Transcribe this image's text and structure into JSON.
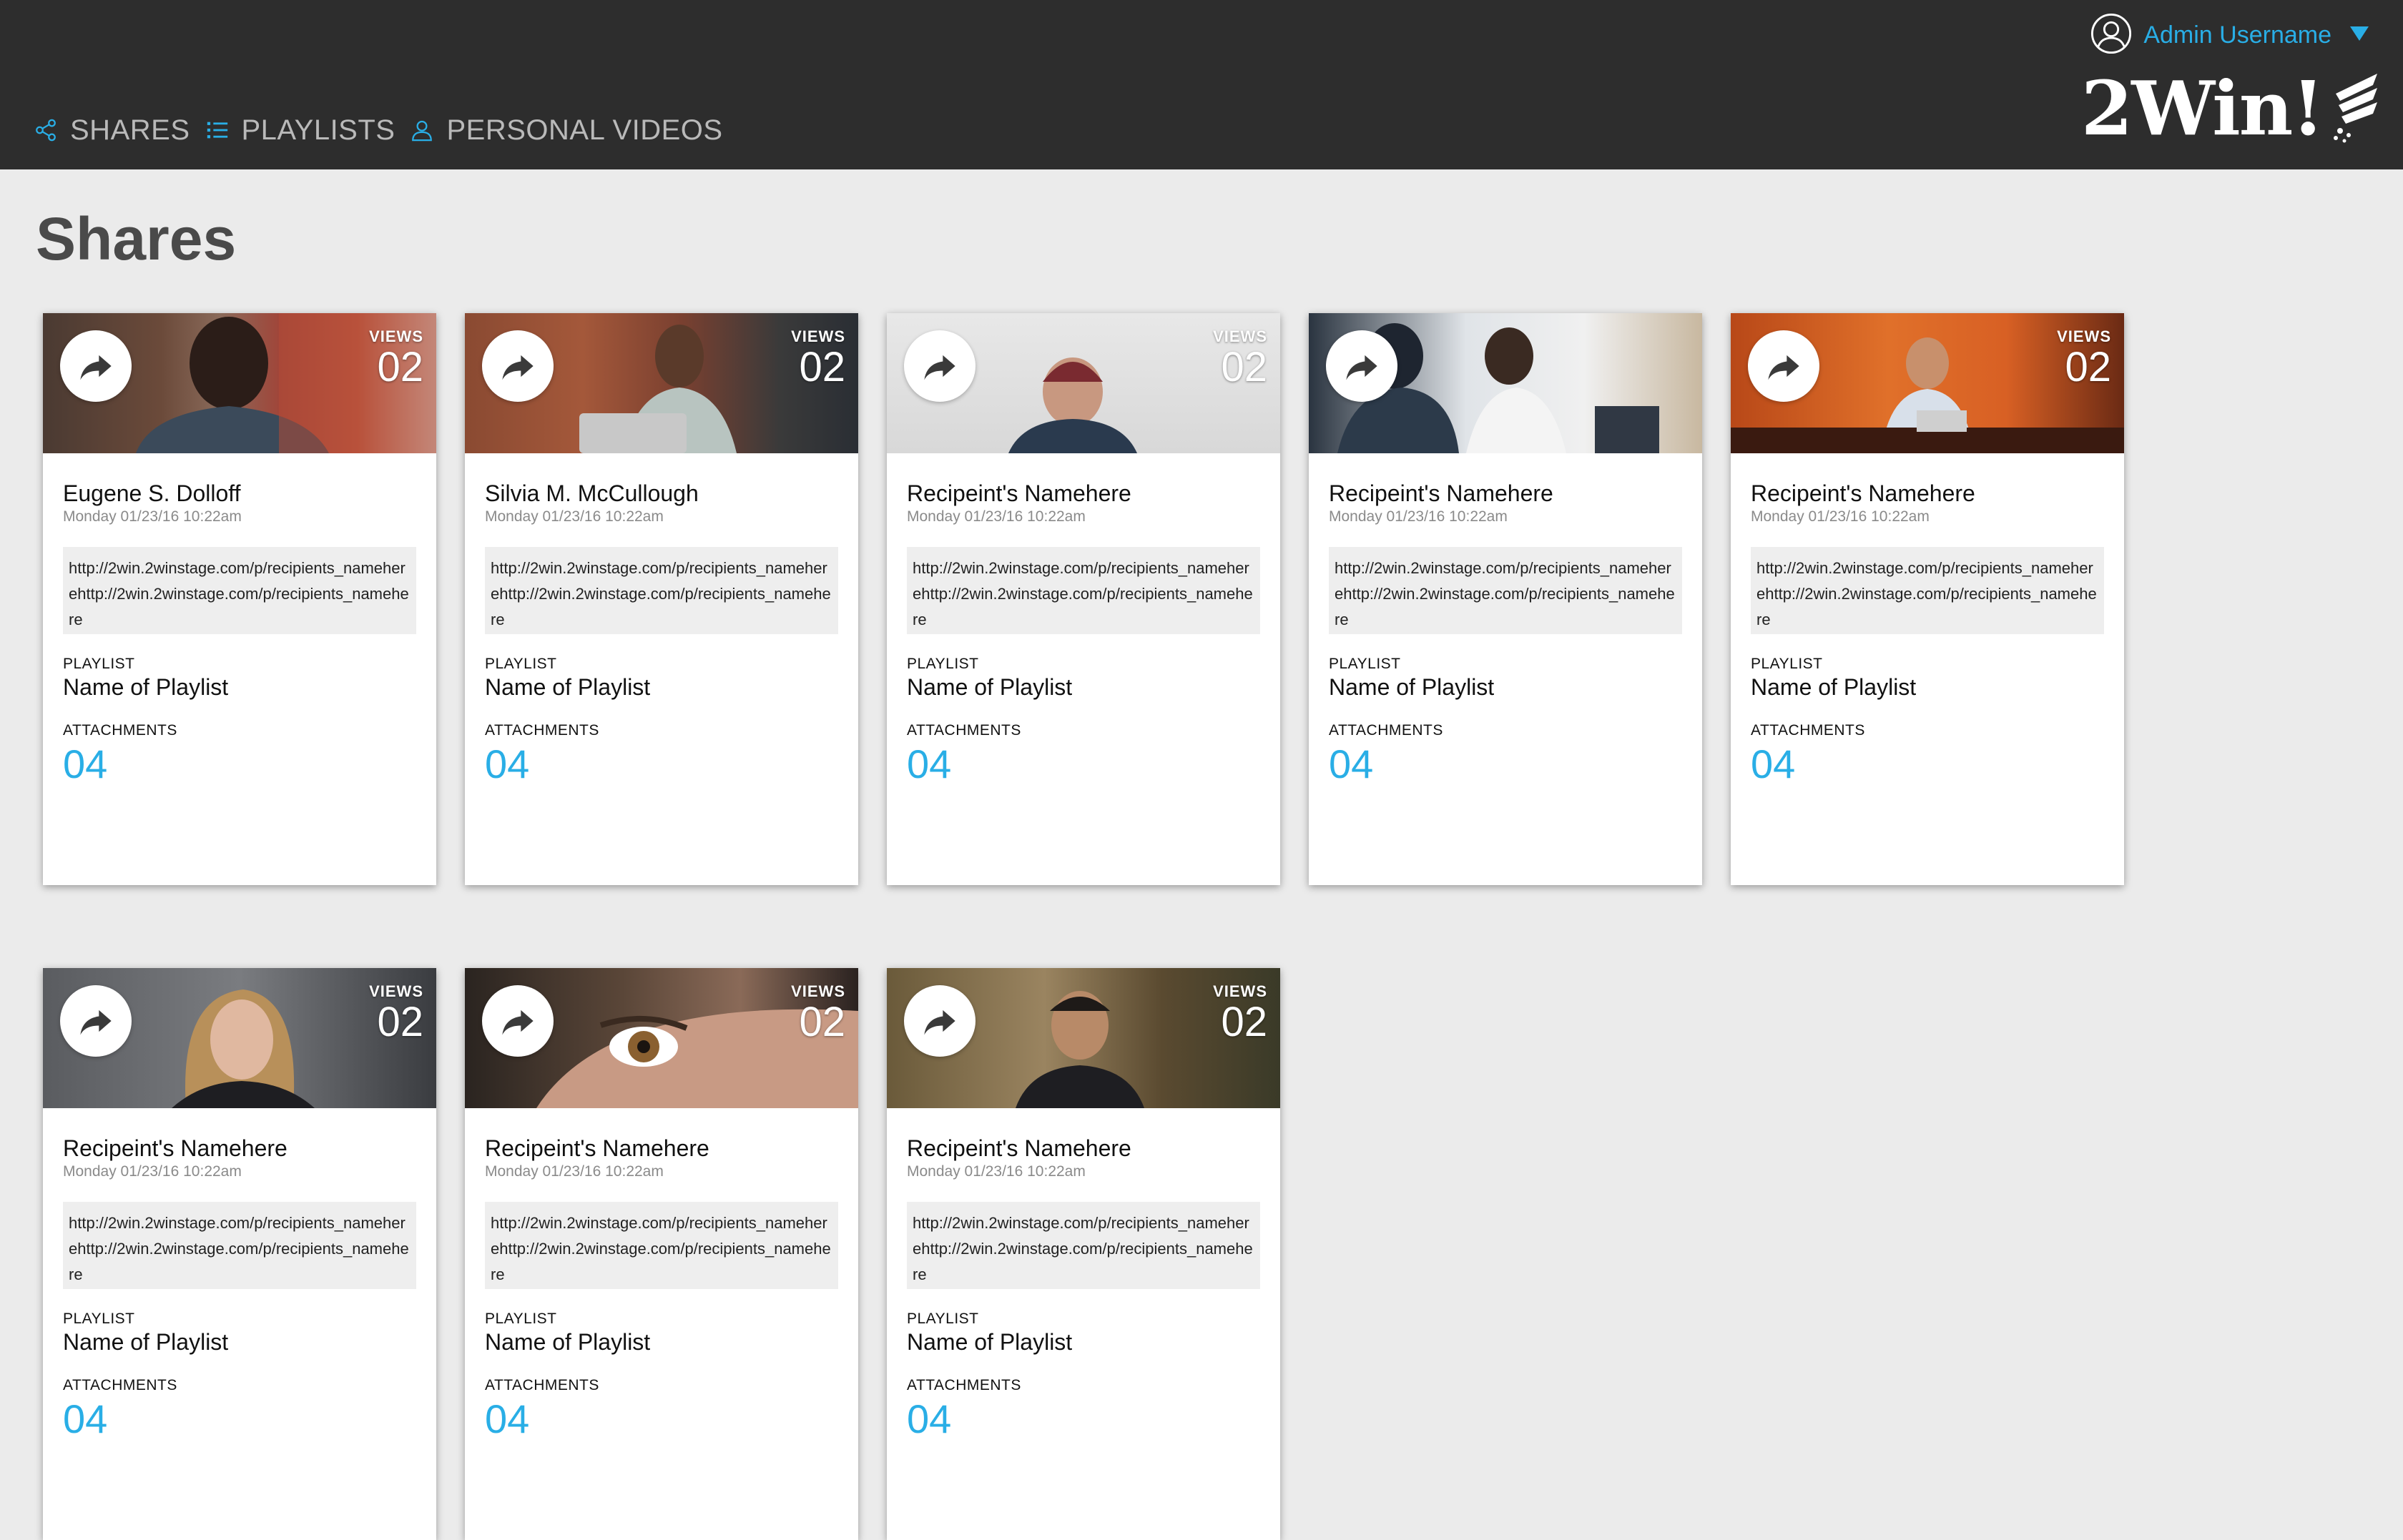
{
  "nav": {
    "items": [
      {
        "label": "SHARES"
      },
      {
        "label": "PLAYLISTS"
      },
      {
        "label": "PERSONAL VIDEOS"
      }
    ]
  },
  "user": {
    "name": "Admin Username",
    "menu_icon": "caret-down-icon"
  },
  "logo": {
    "text": "2Win!"
  },
  "page": {
    "title": "Shares"
  },
  "colors": {
    "accent": "#29aee6",
    "topbar": "#2d2d2d",
    "background": "#ebebeb"
  },
  "cards": [
    {
      "name": "Eugene S. Dolloff",
      "date": "Monday 01/23/16 10:22am",
      "link": "http://2win.2winstage.com/p/recipients_nameherehttp://2win.2winstage.com/p/recipients_namehere",
      "views_label": "VIEWS",
      "views": "02",
      "playlist_label": "PLAYLIST",
      "playlist": "Name of Playlist",
      "attachments_label": "ATTACHMENTS",
      "attachments": "04"
    },
    {
      "name": "Silvia M. McCullough",
      "date": "Monday 01/23/16 10:22am",
      "link": "http://2win.2winstage.com/p/recipients_nameherehttp://2win.2winstage.com/p/recipients_namehere",
      "views_label": "VIEWS",
      "views": "02",
      "playlist_label": "PLAYLIST",
      "playlist": "Name of Playlist",
      "attachments_label": "ATTACHMENTS",
      "attachments": "04"
    },
    {
      "name": "Recipeint's Namehere",
      "date": "Monday 01/23/16 10:22am",
      "link": "http://2win.2winstage.com/p/recipients_nameherehttp://2win.2winstage.com/p/recipients_namehere",
      "views_label": "VIEWS",
      "views": "02",
      "playlist_label": "PLAYLIST",
      "playlist": "Name of Playlist",
      "attachments_label": "ATTACHMENTS",
      "attachments": "04"
    },
    {
      "name": "Recipeint's Namehere",
      "date": "Monday 01/23/16 10:22am",
      "link": "http://2win.2winstage.com/p/recipients_nameherehttp://2win.2winstage.com/p/recipients_namehere",
      "views_label": "VIEWS",
      "views": "02",
      "playlist_label": "PLAYLIST",
      "playlist": "Name of Playlist",
      "attachments_label": "ATTACHMENTS",
      "attachments": "04"
    },
    {
      "name": "Recipeint's Namehere",
      "date": "Monday 01/23/16 10:22am",
      "link": "http://2win.2winstage.com/p/recipients_nameherehttp://2win.2winstage.com/p/recipients_namehere",
      "views_label": "VIEWS",
      "views": "02",
      "playlist_label": "PLAYLIST",
      "playlist": "Name of Playlist",
      "attachments_label": "ATTACHMENTS",
      "attachments": "04"
    },
    {
      "name": "Recipeint's Namehere",
      "date": "Monday 01/23/16 10:22am",
      "link": "http://2win.2winstage.com/p/recipients_nameherehttp://2win.2winstage.com/p/recipients_namehere",
      "views_label": "VIEWS",
      "views": "02",
      "playlist_label": "PLAYLIST",
      "playlist": "Name of Playlist",
      "attachments_label": "ATTACHMENTS",
      "attachments": "04"
    },
    {
      "name": "Recipeint's Namehere",
      "date": "Monday 01/23/16 10:22am",
      "link": "http://2win.2winstage.com/p/recipients_nameherehttp://2win.2winstage.com/p/recipients_namehere",
      "views_label": "VIEWS",
      "views": "02",
      "playlist_label": "PLAYLIST",
      "playlist": "Name of Playlist",
      "attachments_label": "ATTACHMENTS",
      "attachments": "04"
    },
    {
      "name": "Recipeint's Namehere",
      "date": "Monday 01/23/16 10:22am",
      "link": "http://2win.2winstage.com/p/recipients_nameherehttp://2win.2winstage.com/p/recipients_namehere",
      "views_label": "VIEWS",
      "views": "02",
      "playlist_label": "PLAYLIST",
      "playlist": "Name of Playlist",
      "attachments_label": "ATTACHMENTS",
      "attachments": "04"
    }
  ]
}
